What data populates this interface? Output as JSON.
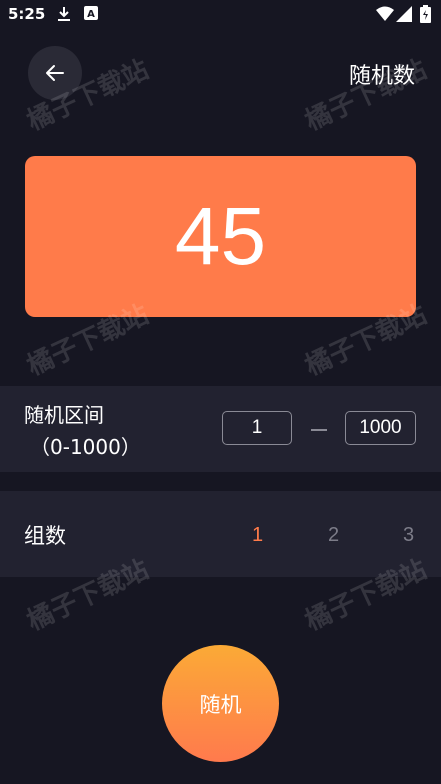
{
  "status_bar": {
    "time": "5:25",
    "icons": [
      "download-icon",
      "a-notification-icon",
      "wifi-icon",
      "signal-icon",
      "battery-icon"
    ]
  },
  "header": {
    "back_icon": "arrow-left-icon",
    "title": "随机数"
  },
  "result": {
    "value": "45",
    "color": "#ff7b4a"
  },
  "range": {
    "label": "随机区间",
    "sublabel": "（0-1000）",
    "min_value": "1",
    "max_value": "1000"
  },
  "groups": {
    "label": "组数",
    "options": [
      "1",
      "2",
      "3"
    ],
    "selected": "1",
    "selected_color": "#ff7b4a"
  },
  "action": {
    "label": "随机"
  },
  "watermark": "橘子下载站"
}
